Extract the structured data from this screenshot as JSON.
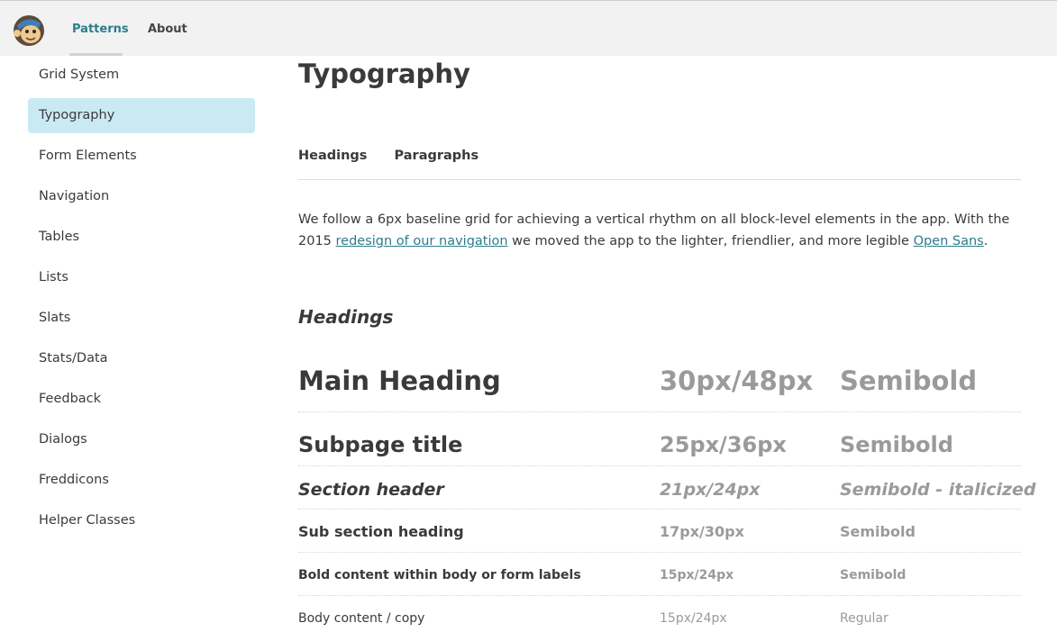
{
  "topnav": {
    "items": [
      {
        "label": "Patterns",
        "active": true
      },
      {
        "label": "About",
        "active": false
      }
    ]
  },
  "sidebar": {
    "items": [
      {
        "label": "Grid System"
      },
      {
        "label": "Typography",
        "active": true
      },
      {
        "label": "Form Elements"
      },
      {
        "label": "Navigation"
      },
      {
        "label": "Tables"
      },
      {
        "label": "Lists"
      },
      {
        "label": "Slats"
      },
      {
        "label": "Stats/Data"
      },
      {
        "label": "Feedback"
      },
      {
        "label": "Dialogs"
      },
      {
        "label": "Freddicons"
      },
      {
        "label": "Helper Classes"
      }
    ]
  },
  "main": {
    "title": "Typography",
    "tabs": [
      {
        "label": "Headings"
      },
      {
        "label": "Paragraphs"
      }
    ],
    "intro": {
      "part1": "We follow a 6px baseline grid for achieving a vertical rhythm on all block-level elements in the app. With the 2015 ",
      "link1": "redesign of our navigation",
      "part2": " we moved the app to the lighter, friendlier, and more legible ",
      "link2": "Open Sans",
      "part3": "."
    },
    "section_heading": "Headings",
    "specs": [
      {
        "name": "Main Heading",
        "size": "30px/48px",
        "weight": "Semibold"
      },
      {
        "name": "Subpage title",
        "size": "25px/36px",
        "weight": "Semibold"
      },
      {
        "name": "Section header",
        "size": "21px/24px",
        "weight": "Semibold - italicized"
      },
      {
        "name": "Sub section heading",
        "size": "17px/30px",
        "weight": "Semibold"
      },
      {
        "name": "Bold content within body or form labels",
        "size": "15px/24px",
        "weight": "Semibold"
      },
      {
        "name": "Body content / copy",
        "size": "15px/24px",
        "weight": "Regular"
      }
    ]
  },
  "colors": {
    "accent": "#2c7d8c",
    "active_bg": "#c9eaf3",
    "topbar_bg": "#f2f2f2"
  }
}
